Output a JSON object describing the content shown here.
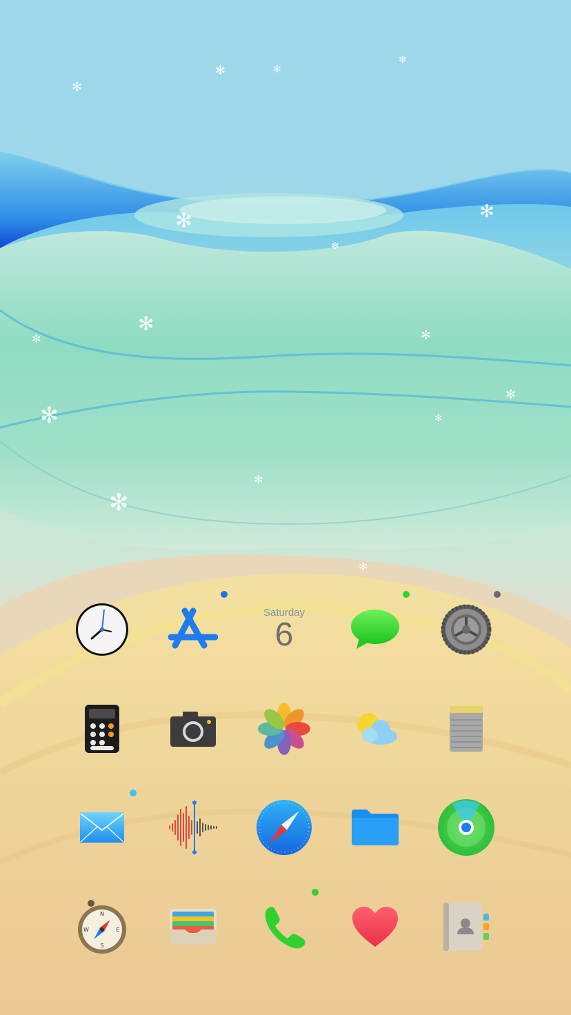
{
  "home_screen": {
    "rows": [
      [
        {
          "name": "clock",
          "icon": "clock-icon"
        },
        {
          "name": "app-store",
          "icon": "app-store-icon"
        },
        {
          "name": "calendar",
          "icon": "calendar-icon",
          "weekday": "Saturday",
          "date": "6"
        },
        {
          "name": "messages",
          "icon": "messages-icon"
        },
        {
          "name": "settings",
          "icon": "gear-icon"
        }
      ],
      [
        {
          "name": "calculator",
          "icon": "calculator-icon"
        },
        {
          "name": "camera",
          "icon": "camera-icon"
        },
        {
          "name": "photos",
          "icon": "photos-icon"
        },
        {
          "name": "weather",
          "icon": "weather-icon"
        },
        {
          "name": "notes",
          "icon": "notes-icon"
        }
      ],
      [
        {
          "name": "mail",
          "icon": "mail-icon"
        },
        {
          "name": "voice-memos",
          "icon": "voice-memos-icon"
        },
        {
          "name": "safari",
          "icon": "safari-icon"
        },
        {
          "name": "files",
          "icon": "folder-icon"
        },
        {
          "name": "find-my",
          "icon": "find-my-icon"
        }
      ],
      [
        {
          "name": "compass",
          "icon": "compass-icon"
        },
        {
          "name": "wallet",
          "icon": "wallet-icon"
        },
        {
          "name": "phone",
          "icon": "phone-icon"
        },
        {
          "name": "health",
          "icon": "heart-icon"
        },
        {
          "name": "contacts",
          "icon": "contacts-icon"
        }
      ]
    ],
    "indicator_colors": {
      "app-store": "#1a73e8",
      "messages": "#2fd12f",
      "settings": "#6b6b6b",
      "mail": "#35c8f0",
      "phone": "#2fd12f"
    }
  }
}
